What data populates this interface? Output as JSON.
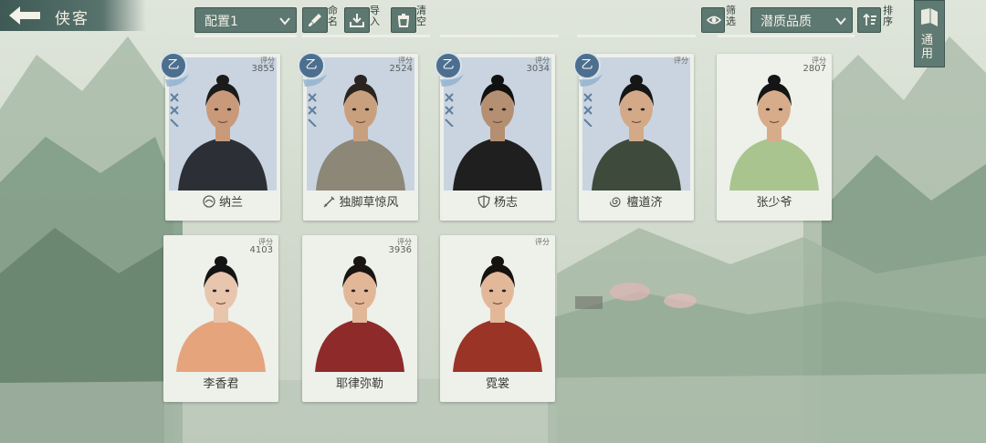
{
  "header": {
    "title": "侠客",
    "config_select": "配置1",
    "rename_label": "命名",
    "import_label": "导入",
    "clear_label": "清空",
    "filter_label": "筛选",
    "sort_select": "潜质品质",
    "order_label": "排序",
    "general_label": "通用"
  },
  "cards": [
    {
      "name": "纳兰",
      "score_label": "评分",
      "score": "3855",
      "grade": "乙",
      "sect_icon": "swirl-icon",
      "bg": "#c9d4e0",
      "skin": "#c89a7a",
      "hair": "#1b1b1b",
      "cloth": "#2c3036"
    },
    {
      "name": "独脚草惊风",
      "score_label": "评分",
      "score": "2524",
      "grade": "乙",
      "sect_icon": "sword-icon",
      "bg": "#c9d4e0",
      "skin": "#c9a07e",
      "hair": "#2a2420",
      "cloth": "#8c8777"
    },
    {
      "name": "杨志",
      "score_label": "评分",
      "score": "3034",
      "grade": "乙",
      "sect_icon": "shield-icon",
      "bg": "#c9d4e0",
      "skin": "#b58f72",
      "hair": "#111111",
      "cloth": "#1f1f20"
    },
    {
      "name": "檀道济",
      "score_label": "评分",
      "score": "",
      "grade": "乙",
      "sect_icon": "spiral-icon",
      "bg": "#c9d4e0",
      "skin": "#d4a988",
      "hair": "#161616",
      "cloth": "#3e4a3c"
    },
    {
      "name": "张少爷",
      "score_label": "评分",
      "score": "2807",
      "grade": "",
      "sect_icon": "",
      "bg": "#eef0ea",
      "skin": "#d7ac8a",
      "hair": "#151515",
      "cloth": "#a9c48e"
    },
    {
      "name": "李香君",
      "score_label": "评分",
      "score": "4103",
      "grade": "",
      "sect_icon": "",
      "bg": "#eef0ea",
      "skin": "#e8c5ad",
      "hair": "#141414",
      "cloth": "#e6a47d"
    },
    {
      "name": "耶律弥勒",
      "score_label": "评分",
      "score": "3936",
      "grade": "",
      "sect_icon": "",
      "bg": "#eef0ea",
      "skin": "#e1b797",
      "hair": "#1a1412",
      "cloth": "#8e2a2a"
    },
    {
      "name": "霓裳",
      "score_label": "评分",
      "score": "",
      "grade": "",
      "sect_icon": "",
      "bg": "#eef0ea",
      "skin": "#e2b899",
      "hair": "#161210",
      "cloth": "#9a3427"
    }
  ]
}
